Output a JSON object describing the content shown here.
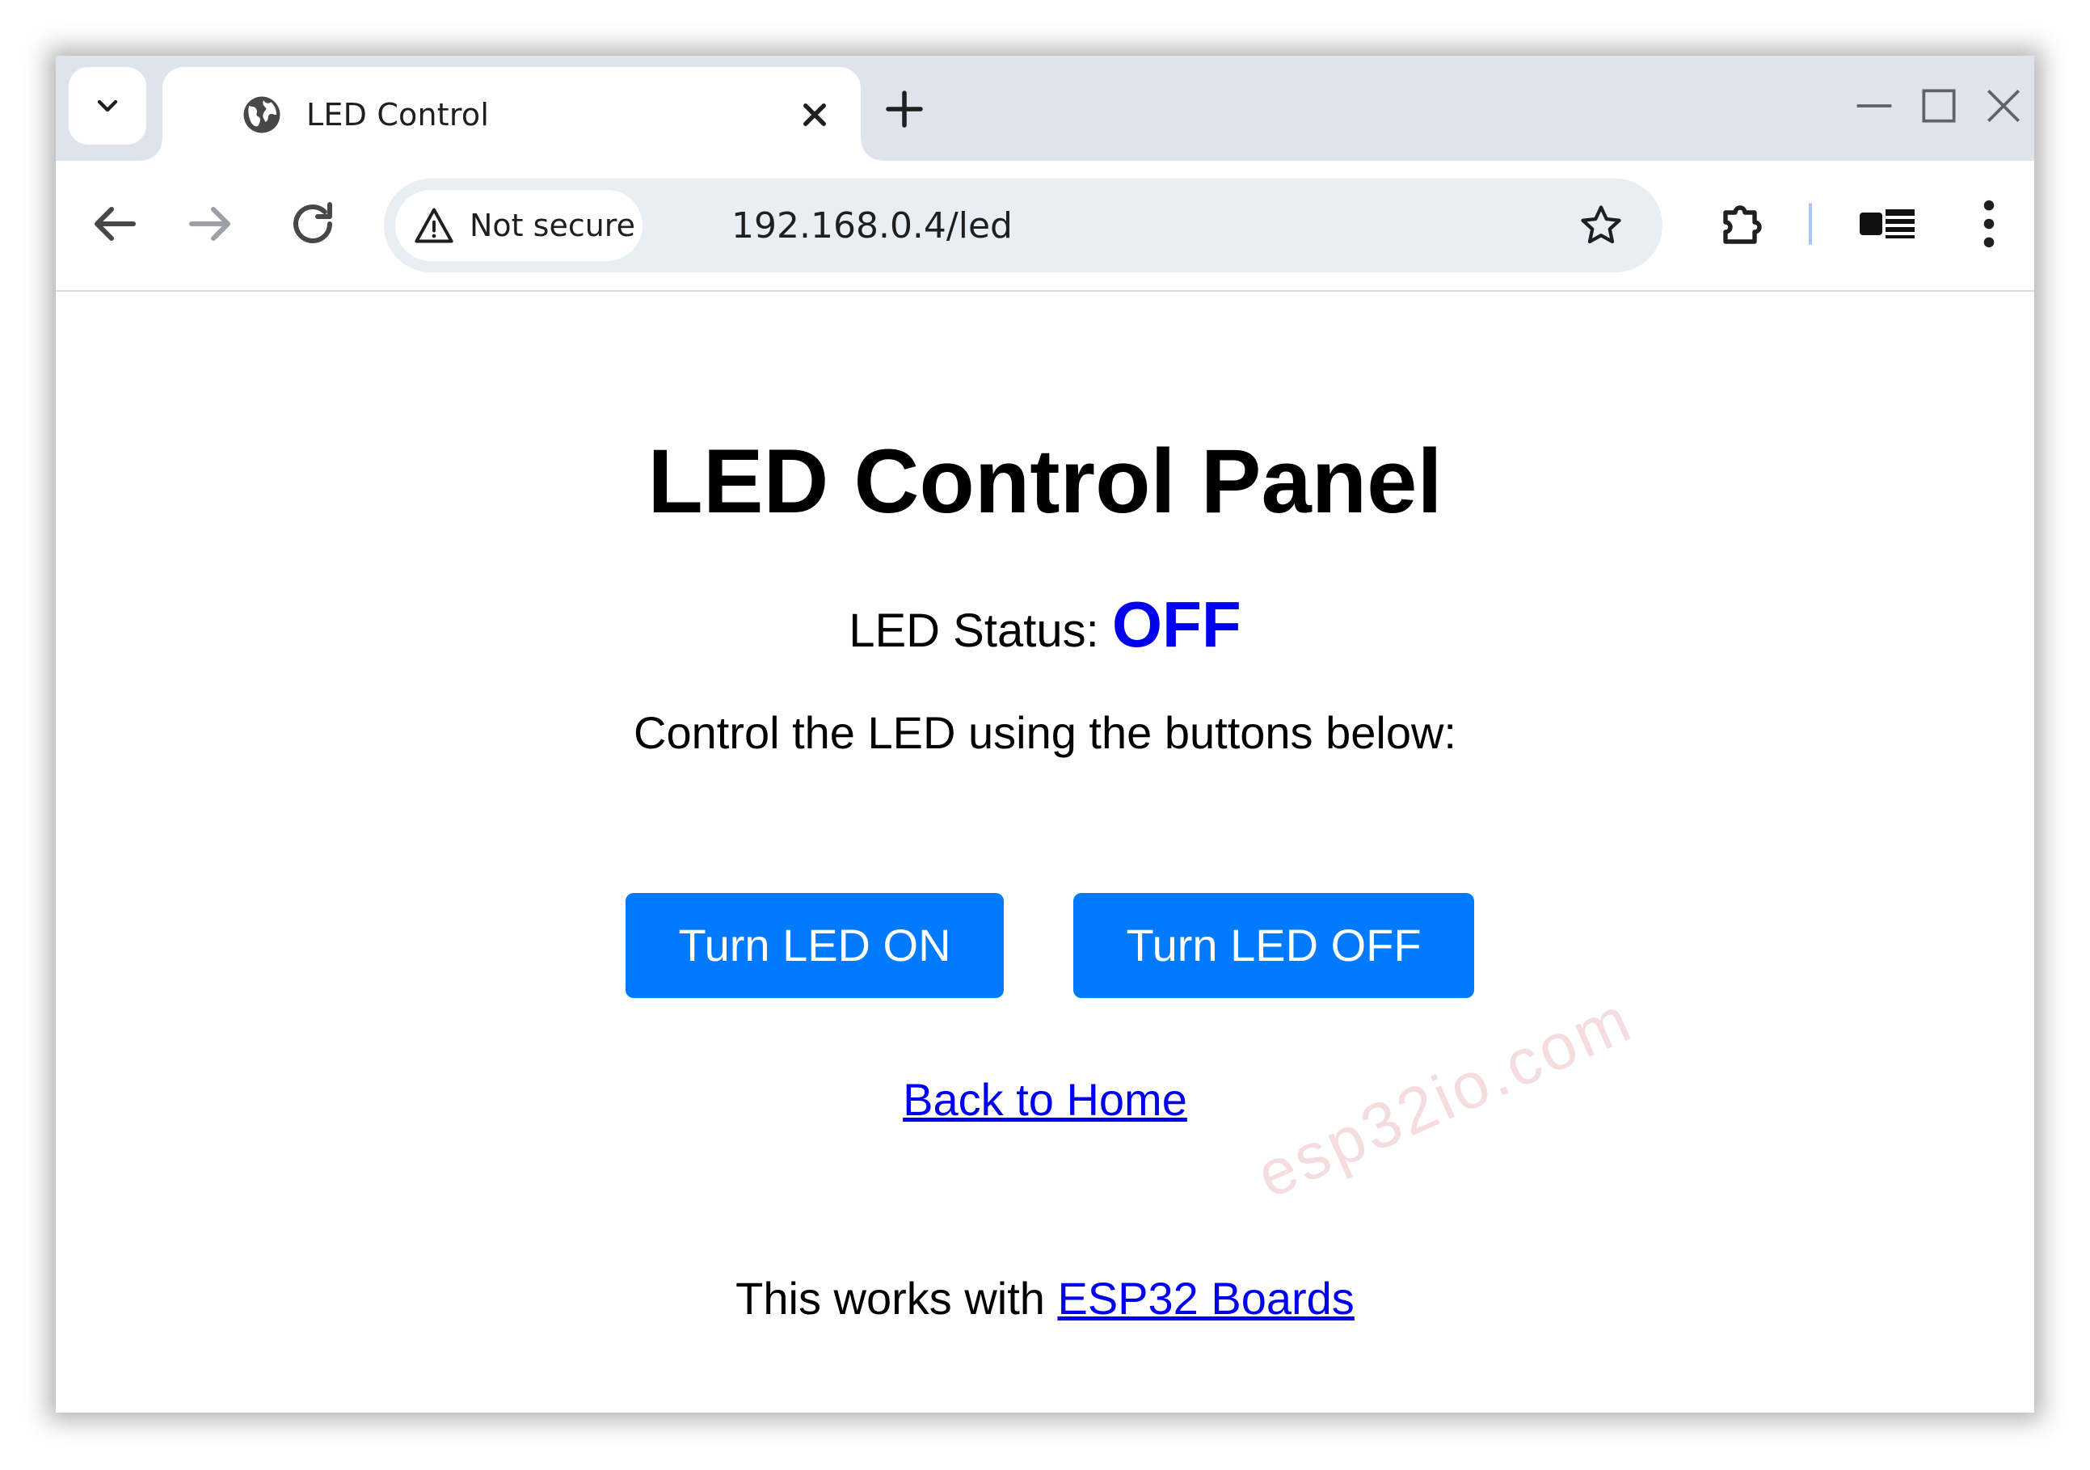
{
  "browser": {
    "tab_title": "LED Control",
    "security_label": "Not secure",
    "url": "192.168.0.4/led"
  },
  "page": {
    "title": "LED Control Panel",
    "status_label": "LED Status: ",
    "status_value": "OFF",
    "instructions": "Control the LED using the buttons below:",
    "button_on": "Turn LED ON",
    "button_off": "Turn LED OFF",
    "home_link": "Back to Home",
    "footer_prefix": "This works with ",
    "footer_link": "ESP32 Boards",
    "watermark": "esp32io.com"
  },
  "colors": {
    "button_bg": "#007bff",
    "status_value": "#0000ee",
    "link": "#0000ee"
  }
}
